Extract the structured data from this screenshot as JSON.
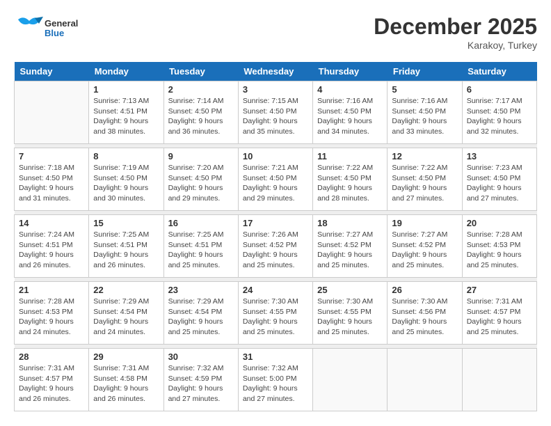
{
  "header": {
    "logo_general": "General",
    "logo_blue": "Blue",
    "month": "December 2025",
    "location": "Karakoy, Turkey"
  },
  "days_of_week": [
    "Sunday",
    "Monday",
    "Tuesday",
    "Wednesday",
    "Thursday",
    "Friday",
    "Saturday"
  ],
  "weeks": [
    [
      {
        "day": "",
        "sunrise": "",
        "sunset": "",
        "daylight": ""
      },
      {
        "day": "1",
        "sunrise": "7:13 AM",
        "sunset": "4:51 PM",
        "daylight": "9 hours and 38 minutes."
      },
      {
        "day": "2",
        "sunrise": "7:14 AM",
        "sunset": "4:50 PM",
        "daylight": "9 hours and 36 minutes."
      },
      {
        "day": "3",
        "sunrise": "7:15 AM",
        "sunset": "4:50 PM",
        "daylight": "9 hours and 35 minutes."
      },
      {
        "day": "4",
        "sunrise": "7:16 AM",
        "sunset": "4:50 PM",
        "daylight": "9 hours and 34 minutes."
      },
      {
        "day": "5",
        "sunrise": "7:16 AM",
        "sunset": "4:50 PM",
        "daylight": "9 hours and 33 minutes."
      },
      {
        "day": "6",
        "sunrise": "7:17 AM",
        "sunset": "4:50 PM",
        "daylight": "9 hours and 32 minutes."
      }
    ],
    [
      {
        "day": "7",
        "sunrise": "7:18 AM",
        "sunset": "4:50 PM",
        "daylight": "9 hours and 31 minutes."
      },
      {
        "day": "8",
        "sunrise": "7:19 AM",
        "sunset": "4:50 PM",
        "daylight": "9 hours and 30 minutes."
      },
      {
        "day": "9",
        "sunrise": "7:20 AM",
        "sunset": "4:50 PM",
        "daylight": "9 hours and 29 minutes."
      },
      {
        "day": "10",
        "sunrise": "7:21 AM",
        "sunset": "4:50 PM",
        "daylight": "9 hours and 29 minutes."
      },
      {
        "day": "11",
        "sunrise": "7:22 AM",
        "sunset": "4:50 PM",
        "daylight": "9 hours and 28 minutes."
      },
      {
        "day": "12",
        "sunrise": "7:22 AM",
        "sunset": "4:50 PM",
        "daylight": "9 hours and 27 minutes."
      },
      {
        "day": "13",
        "sunrise": "7:23 AM",
        "sunset": "4:50 PM",
        "daylight": "9 hours and 27 minutes."
      }
    ],
    [
      {
        "day": "14",
        "sunrise": "7:24 AM",
        "sunset": "4:51 PM",
        "daylight": "9 hours and 26 minutes."
      },
      {
        "day": "15",
        "sunrise": "7:25 AM",
        "sunset": "4:51 PM",
        "daylight": "9 hours and 26 minutes."
      },
      {
        "day": "16",
        "sunrise": "7:25 AM",
        "sunset": "4:51 PM",
        "daylight": "9 hours and 25 minutes."
      },
      {
        "day": "17",
        "sunrise": "7:26 AM",
        "sunset": "4:52 PM",
        "daylight": "9 hours and 25 minutes."
      },
      {
        "day": "18",
        "sunrise": "7:27 AM",
        "sunset": "4:52 PM",
        "daylight": "9 hours and 25 minutes."
      },
      {
        "day": "19",
        "sunrise": "7:27 AM",
        "sunset": "4:52 PM",
        "daylight": "9 hours and 25 minutes."
      },
      {
        "day": "20",
        "sunrise": "7:28 AM",
        "sunset": "4:53 PM",
        "daylight": "9 hours and 25 minutes."
      }
    ],
    [
      {
        "day": "21",
        "sunrise": "7:28 AM",
        "sunset": "4:53 PM",
        "daylight": "9 hours and 24 minutes."
      },
      {
        "day": "22",
        "sunrise": "7:29 AM",
        "sunset": "4:54 PM",
        "daylight": "9 hours and 24 minutes."
      },
      {
        "day": "23",
        "sunrise": "7:29 AM",
        "sunset": "4:54 PM",
        "daylight": "9 hours and 25 minutes."
      },
      {
        "day": "24",
        "sunrise": "7:30 AM",
        "sunset": "4:55 PM",
        "daylight": "9 hours and 25 minutes."
      },
      {
        "day": "25",
        "sunrise": "7:30 AM",
        "sunset": "4:55 PM",
        "daylight": "9 hours and 25 minutes."
      },
      {
        "day": "26",
        "sunrise": "7:30 AM",
        "sunset": "4:56 PM",
        "daylight": "9 hours and 25 minutes."
      },
      {
        "day": "27",
        "sunrise": "7:31 AM",
        "sunset": "4:57 PM",
        "daylight": "9 hours and 25 minutes."
      }
    ],
    [
      {
        "day": "28",
        "sunrise": "7:31 AM",
        "sunset": "4:57 PM",
        "daylight": "9 hours and 26 minutes."
      },
      {
        "day": "29",
        "sunrise": "7:31 AM",
        "sunset": "4:58 PM",
        "daylight": "9 hours and 26 minutes."
      },
      {
        "day": "30",
        "sunrise": "7:32 AM",
        "sunset": "4:59 PM",
        "daylight": "9 hours and 27 minutes."
      },
      {
        "day": "31",
        "sunrise": "7:32 AM",
        "sunset": "5:00 PM",
        "daylight": "9 hours and 27 minutes."
      },
      {
        "day": "",
        "sunrise": "",
        "sunset": "",
        "daylight": ""
      },
      {
        "day": "",
        "sunrise": "",
        "sunset": "",
        "daylight": ""
      },
      {
        "day": "",
        "sunrise": "",
        "sunset": "",
        "daylight": ""
      }
    ]
  ]
}
